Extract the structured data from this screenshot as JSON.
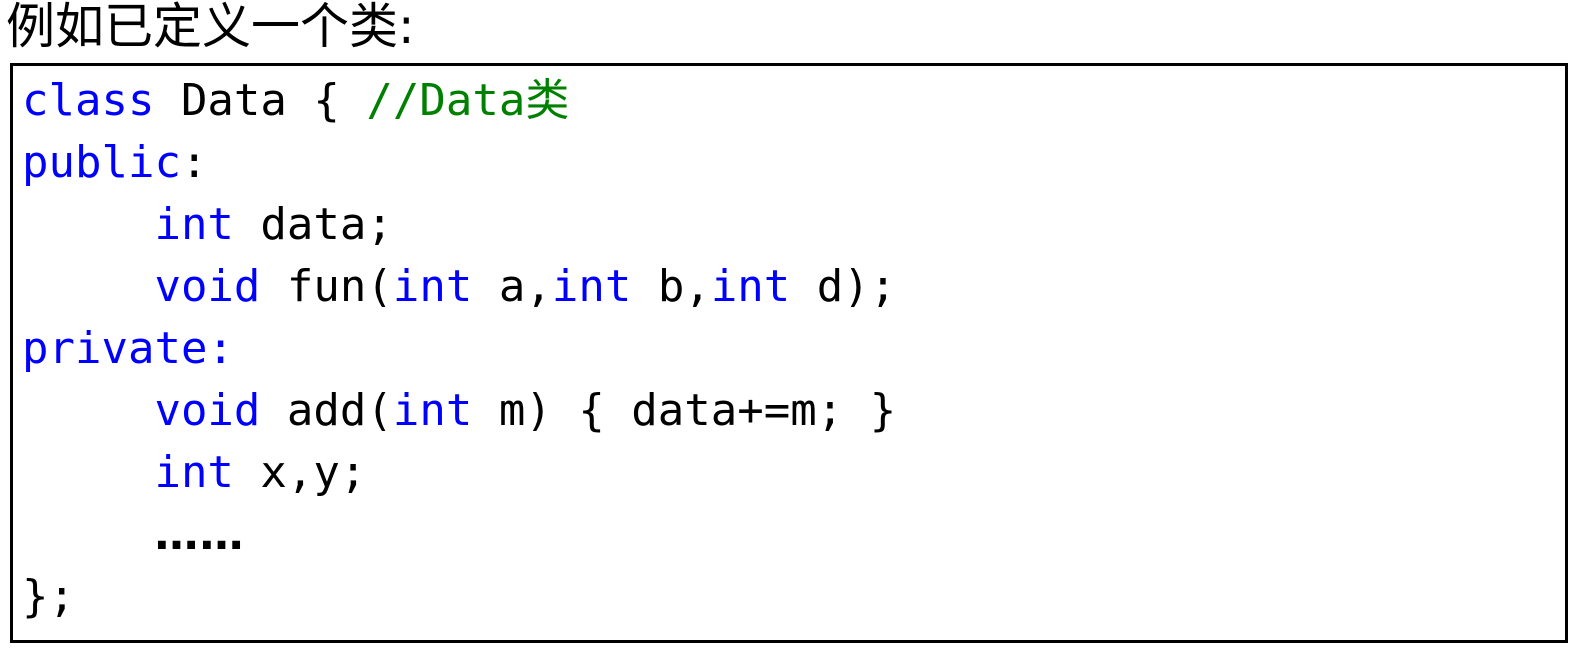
{
  "slide": {
    "heading": "例如已定义一个类:",
    "colors": {
      "keyword": "#0000FF",
      "comment": "#008000",
      "text": "#000000",
      "border": "#000000",
      "background": "#FFFFFF"
    }
  },
  "code": {
    "language": "C++",
    "plain_text": "class Data { //Data类\npublic:\n     int data;\n     void fun(int a,int b,int d);\nprivate:\n     void add(int m) { data+=m; }\n     int x,y;\n     ……\n};",
    "lines": [
      {
        "id": "line-1",
        "indent": "",
        "tokens": [
          {
            "t": "class",
            "k": "kw"
          },
          {
            "t": " Data { ",
            "k": "plain"
          },
          {
            "t": "//Data类",
            "k": "cmt"
          }
        ]
      },
      {
        "id": "line-2",
        "indent": "",
        "tokens": [
          {
            "t": "public",
            "k": "kw"
          },
          {
            "t": ":",
            "k": "plain"
          }
        ]
      },
      {
        "id": "line-3",
        "indent": "     ",
        "tokens": [
          {
            "t": "int",
            "k": "kw"
          },
          {
            "t": " data;",
            "k": "plain"
          }
        ]
      },
      {
        "id": "line-4",
        "indent": "     ",
        "tokens": [
          {
            "t": "void",
            "k": "kw"
          },
          {
            "t": " fun(",
            "k": "plain"
          },
          {
            "t": "int",
            "k": "kw"
          },
          {
            "t": " a,",
            "k": "plain"
          },
          {
            "t": "int",
            "k": "kw"
          },
          {
            "t": " b,",
            "k": "plain"
          },
          {
            "t": "int",
            "k": "kw"
          },
          {
            "t": " d);",
            "k": "plain"
          }
        ]
      },
      {
        "id": "line-5",
        "indent": "",
        "tokens": [
          {
            "t": "private:",
            "k": "kw"
          }
        ]
      },
      {
        "id": "line-6",
        "indent": "     ",
        "tokens": [
          {
            "t": "void",
            "k": "kw"
          },
          {
            "t": " add(",
            "k": "plain"
          },
          {
            "t": "int",
            "k": "kw"
          },
          {
            "t": " m) { data+=m; }",
            "k": "plain"
          }
        ]
      },
      {
        "id": "line-7",
        "indent": "     ",
        "tokens": [
          {
            "t": "int",
            "k": "kw"
          },
          {
            "t": " x,y;",
            "k": "plain"
          }
        ]
      },
      {
        "id": "line-8",
        "indent": "     ",
        "tokens": [
          {
            "t": "……",
            "k": "dots"
          }
        ]
      },
      {
        "id": "line-9",
        "indent": "",
        "tokens": [
          {
            "t": "};",
            "k": "plain"
          }
        ]
      }
    ]
  }
}
